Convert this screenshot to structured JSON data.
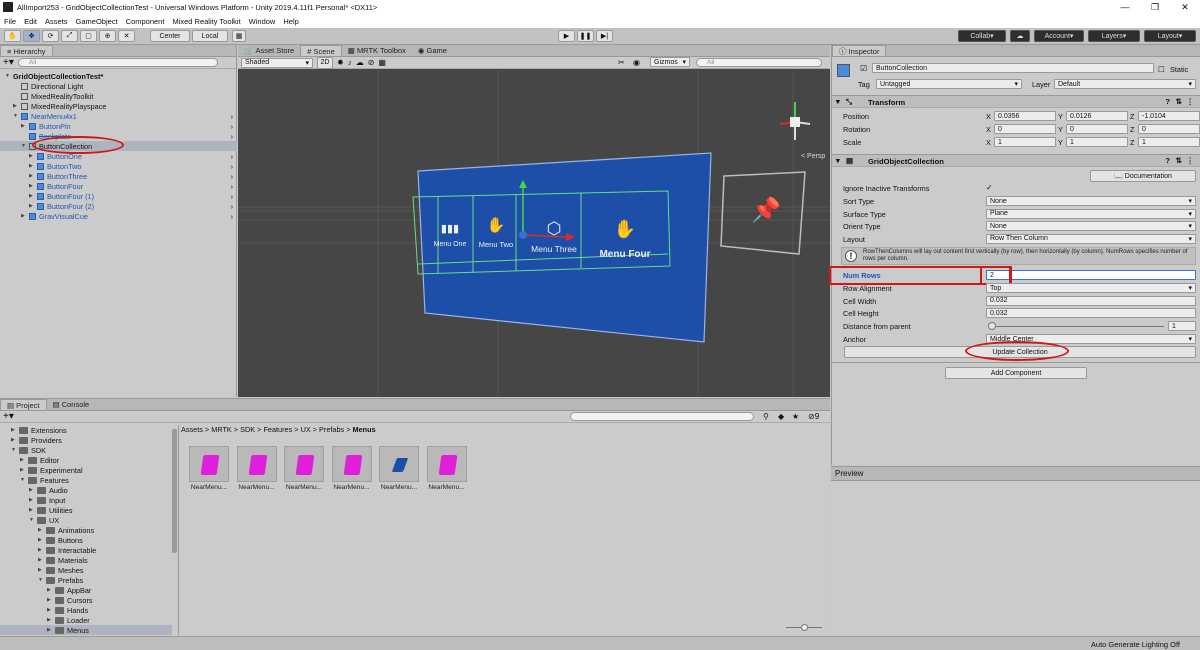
{
  "window": {
    "title": "AllImport253 - GridObjectCollectionTest - Universal Windows Platform - Unity 2019.4.11f1 Personal* <DX11>",
    "controls": [
      "—",
      "❐",
      "✕"
    ]
  },
  "menu": [
    "File",
    "Edit",
    "Assets",
    "GameObject",
    "Component",
    "Mixed Reality Toolkit",
    "Window",
    "Help"
  ],
  "toolbar": {
    "pivot": "Center",
    "space": "Local",
    "collab": "Collab",
    "account": "Account",
    "layers": "Layers",
    "layout": "Layout"
  },
  "hierarchy": {
    "tab": "Hierarchy",
    "search_placeholder": "All",
    "rows": [
      {
        "label": "GridObjectCollectionTest*",
        "indent": 0,
        "bold": true,
        "blue": false,
        "expanded": true
      },
      {
        "label": "Directional Light",
        "indent": 1,
        "blue": false
      },
      {
        "label": "MixedRealityToolkit",
        "indent": 1,
        "blue": false
      },
      {
        "label": "MixedRealityPlayspace",
        "indent": 1,
        "blue": false,
        "collapsed": true
      },
      {
        "label": "NearMenu4x1",
        "indent": 1,
        "blue": true,
        "expanded": true
      },
      {
        "label": "ButtonPin",
        "indent": 2,
        "blue": true,
        "collapsed": true
      },
      {
        "label": "Backplate",
        "indent": 2,
        "blue": true,
        "strike": true
      },
      {
        "label": "ButtonCollection",
        "indent": 2,
        "blue": false,
        "expanded": true,
        "selected": true
      },
      {
        "label": "ButtonOne",
        "indent": 3,
        "blue": true,
        "collapsed": true
      },
      {
        "label": "ButtonTwo",
        "indent": 3,
        "blue": true,
        "collapsed": true
      },
      {
        "label": "ButtonThree",
        "indent": 3,
        "blue": true,
        "collapsed": true
      },
      {
        "label": "ButtonFour",
        "indent": 3,
        "blue": true,
        "collapsed": true
      },
      {
        "label": "ButtonFour (1)",
        "indent": 3,
        "blue": true,
        "collapsed": true
      },
      {
        "label": "ButtonFour (2)",
        "indent": 3,
        "blue": true,
        "collapsed": true
      },
      {
        "label": "GravVisualCue",
        "indent": 2,
        "blue": true,
        "collapsed": true
      }
    ]
  },
  "scene": {
    "tabs": [
      "Asset Store",
      "Scene",
      "MRTK Toolbox",
      "Game"
    ],
    "shading": "Shaded",
    "mode_2d": "2D",
    "gizmos": "Gizmos",
    "search_placeholder": "All",
    "persp": "< Persp",
    "buttons": [
      "Menu One",
      "Menu Two",
      "Menu Three",
      "Menu Four"
    ]
  },
  "inspector": {
    "tab": "Inspector",
    "object_name": "ButtonCollection",
    "static_label": "Static",
    "tag_label": "Tag",
    "tag_value": "Untagged",
    "layer_label": "Layer",
    "layer_value": "Default",
    "transform_title": "Transform",
    "transform": [
      {
        "label": "Position",
        "x": "0.0356",
        "y": "0.0126",
        "z": "-1.0104"
      },
      {
        "label": "Rotation",
        "x": "0",
        "y": "0",
        "z": "0"
      },
      {
        "label": "Scale",
        "x": "1",
        "y": "1",
        "z": "1"
      }
    ],
    "grid_title": "GridObjectCollection",
    "documentation": "Documentation",
    "ignore_inactive": "Ignore Inactive Transforms",
    "fields": [
      {
        "label": "Sort Type",
        "value": "None",
        "dd": true
      },
      {
        "label": "Surface Type",
        "value": "Plane",
        "dd": true
      },
      {
        "label": "Orient Type",
        "value": "None",
        "dd": true
      },
      {
        "label": "Layout",
        "value": "Row Then Column",
        "dd": true
      }
    ],
    "help_text": "RowThenColumns will lay out content first vertically (by row), then horizontally (by column). NumRows specifies number of rows per column.",
    "num_rows_label": "Num Rows",
    "num_rows_value": "2",
    "fields2": [
      {
        "label": "Row Alignment",
        "value": "Top",
        "dd": true
      },
      {
        "label": "Cell Width",
        "value": "0.032",
        "dd": false
      },
      {
        "label": "Cell Height",
        "value": "0.032",
        "dd": false
      }
    ],
    "distance_label": "Distance from parent",
    "distance_value": "1",
    "anchor_label": "Anchor",
    "anchor_value": "Middle Center",
    "update_button": "Update Collection",
    "add_component": "Add Component",
    "preview": "Preview"
  },
  "project": {
    "tabs": [
      "Project",
      "Console"
    ],
    "tree": [
      {
        "label": "Extensions",
        "indent": 1
      },
      {
        "label": "Providers",
        "indent": 1
      },
      {
        "label": "SDK",
        "indent": 1,
        "open": true
      },
      {
        "label": "Editor",
        "indent": 2
      },
      {
        "label": "Experimental",
        "indent": 2
      },
      {
        "label": "Features",
        "indent": 2,
        "open": true
      },
      {
        "label": "Audio",
        "indent": 3
      },
      {
        "label": "Input",
        "indent": 3
      },
      {
        "label": "Utilities",
        "indent": 3
      },
      {
        "label": "UX",
        "indent": 3,
        "open": true
      },
      {
        "label": "Animations",
        "indent": 4
      },
      {
        "label": "Buttons",
        "indent": 4
      },
      {
        "label": "Interactable",
        "indent": 4
      },
      {
        "label": "Materials",
        "indent": 4
      },
      {
        "label": "Meshes",
        "indent": 4
      },
      {
        "label": "Prefabs",
        "indent": 4,
        "open": true
      },
      {
        "label": "AppBar",
        "indent": 5
      },
      {
        "label": "Cursors",
        "indent": 5
      },
      {
        "label": "Hands",
        "indent": 5
      },
      {
        "label": "Loader",
        "indent": 5
      },
      {
        "label": "Menus",
        "indent": 5,
        "selected": true
      }
    ],
    "breadcrumb": [
      "Assets",
      "MRTK",
      "SDK",
      "Features",
      "UX",
      "Prefabs",
      "Menus"
    ],
    "assets": [
      "NearMenu...",
      "NearMenu...",
      "NearMenu...",
      "NearMenu...",
      "NearMenu...",
      "NearMenu..."
    ],
    "hidden_count": "9"
  },
  "status": "Auto Generate Lighting Off",
  "colors": {
    "accent": "#d01818",
    "menu_blue": "#1e4fa8",
    "magenta": "#e020d8"
  }
}
